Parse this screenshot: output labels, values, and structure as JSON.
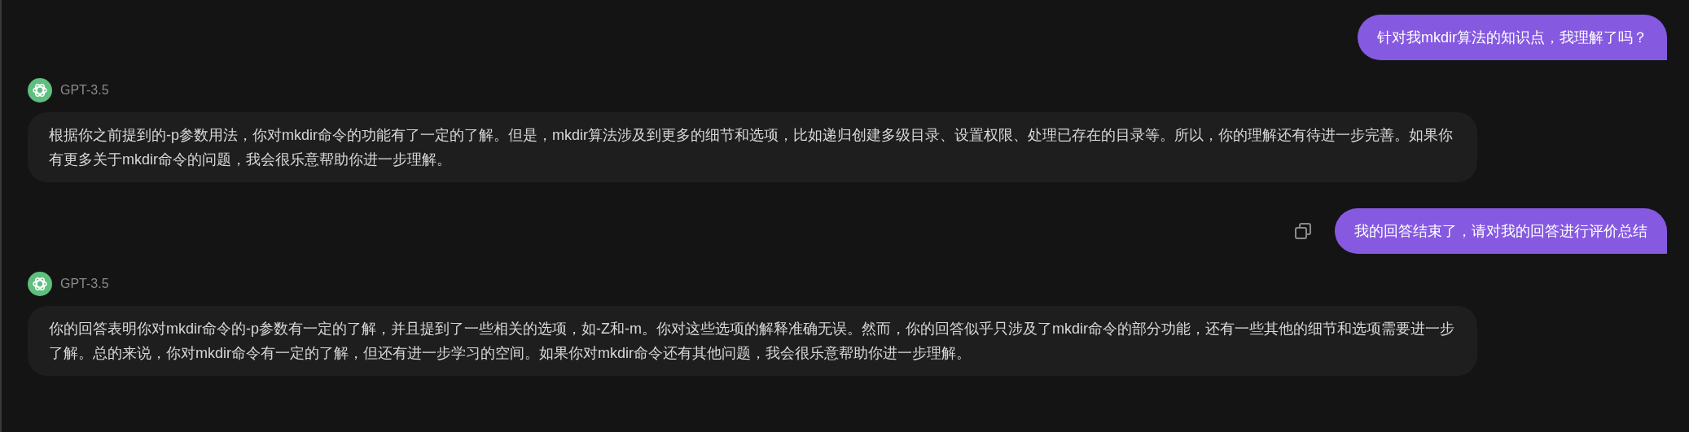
{
  "messages": [
    {
      "kind": "user",
      "text": "针对我mkdir算法的知识点，我理解了吗？",
      "copy_icon": false
    },
    {
      "kind": "assistant",
      "model": "GPT-3.5",
      "text": "根据你之前提到的-p参数用法，你对mkdir命令的功能有了一定的了解。但是，mkdir算法涉及到更多的细节和选项，比如递归创建多级目录、设置权限、处理已存在的目录等。所以，你的理解还有待进一步完善。如果你有更多关于mkdir命令的问题，我会很乐意帮助你进一步理解。"
    },
    {
      "kind": "user",
      "text": "我的回答结束了，请对我的回答进行评价总结",
      "copy_icon": true
    },
    {
      "kind": "assistant",
      "model": "GPT-3.5",
      "text": "你的回答表明你对mkdir命令的-p参数有一定的了解，并且提到了一些相关的选项，如-Z和-m。你对这些选项的解释准确无误。然而，你的回答似乎只涉及了mkdir命令的部分功能，还有一些其他的细节和选项需要进一步了解。总的来说，你对mkdir命令有一定的了解，但还有进一步学习的空间。如果你对mkdir命令还有其他问题，我会很乐意帮助你进一步理解。"
    }
  ]
}
